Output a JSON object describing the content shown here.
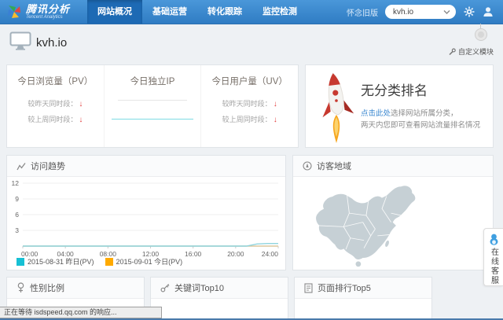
{
  "header": {
    "logo_title": "腾讯分析",
    "logo_subtitle": "Tencent Analytics",
    "nav": [
      {
        "label": "网站概况",
        "active": true
      },
      {
        "label": "基础运营",
        "active": false
      },
      {
        "label": "转化跟踪",
        "active": false
      },
      {
        "label": "监控检测",
        "active": false
      }
    ],
    "old_version_label": "怀念旧版",
    "site_selector": {
      "value": "kvh.io"
    }
  },
  "site_bar": {
    "title": "kvh.io",
    "customize_label": "自定义模块"
  },
  "stats": {
    "arrow_down": "↓",
    "pv": {
      "title": "今日浏览量（PV）",
      "compare": [
        {
          "label": "较昨天同时段：",
          "trend": "down"
        },
        {
          "label": "较上周同时段：",
          "trend": "down"
        }
      ]
    },
    "ip": {
      "title": "今日独立IP"
    },
    "uv": {
      "title": "今日用户量（UV）",
      "compare": [
        {
          "label": "较昨天同时段：",
          "trend": "down"
        },
        {
          "label": "较上周同时段：",
          "trend": "down"
        }
      ]
    }
  },
  "ranking": {
    "title": "无分类排名",
    "link_text": "点击此处",
    "line1_rest": "选择网站所属分类，",
    "line2": "两天内您即可查看网站流量排名情况"
  },
  "panels": {
    "trend": {
      "title": "访问趋势"
    },
    "region": {
      "title": "访客地域"
    },
    "gender": {
      "title": "性别比例"
    },
    "keywords": {
      "title": "关键词Top10"
    },
    "pages": {
      "title": "页面排行Top5"
    }
  },
  "online_service_label": "在线客服",
  "status_bar_text": "正在等待 isdspeed.qq.com 的响应...",
  "chart_data": {
    "type": "line",
    "title": "访问趋势",
    "x_unit": "hour",
    "x_hours_range": [
      0,
      24
    ],
    "x_ticks": [
      "00:00",
      "04:00",
      "08:00",
      "12:00",
      "16:00",
      "20:00",
      "24:00"
    ],
    "ylim": [
      0,
      12
    ],
    "yticks": [
      3,
      6,
      9,
      12
    ],
    "grid": true,
    "legend_position": "bottom-left",
    "series": [
      {
        "name": "2015-08-31 昨日(PV)",
        "swatch_color": "#17c0d4",
        "line_color": "#8fd4de",
        "values": [
          0,
          0,
          0,
          0,
          0,
          0,
          0,
          0,
          0,
          0,
          0,
          0,
          0,
          0,
          0,
          0,
          0,
          0,
          0,
          0,
          0,
          0,
          0.4,
          0.5,
          0.5
        ]
      },
      {
        "name": "2015-09-01 今日(PV)",
        "swatch_color": "#ffaa00",
        "line_color": "#dcc79e",
        "values": [
          0,
          0,
          0,
          0,
          0,
          0,
          0,
          0,
          0,
          0,
          0,
          0,
          0,
          0,
          0,
          0,
          0,
          0,
          0,
          0,
          0,
          0,
          0,
          0,
          0
        ]
      }
    ]
  },
  "colors": {
    "header_blue": "#3c87cd",
    "nav_active_blue": "#1d6ab4",
    "accent_link": "#3a87d0",
    "negative_red": "#e23b3b",
    "page_bg": "#eef1f4",
    "card_border": "#e0e4e8",
    "map_fill": "#c6d0d5"
  }
}
